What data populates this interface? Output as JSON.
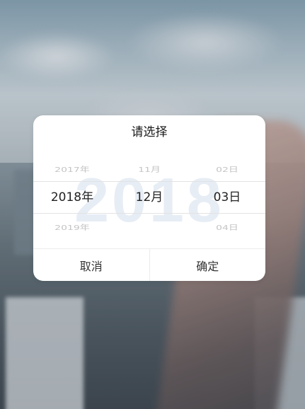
{
  "dialog": {
    "title": "请选择",
    "watermark": "2018",
    "columns": {
      "year": {
        "prev": "2017年",
        "selected": "2018年",
        "next": "2019年"
      },
      "month": {
        "prev": "11月",
        "selected": "12月",
        "next": ""
      },
      "day": {
        "prev": "02日",
        "selected": "03日",
        "next": "04日"
      }
    },
    "cancel_label": "取消",
    "confirm_label": "确定"
  },
  "colors": {
    "watermark": "#e7edf5",
    "divider": "#e2e2e2",
    "text_selected": "#222222",
    "text_faded": "#c4c4c4"
  }
}
